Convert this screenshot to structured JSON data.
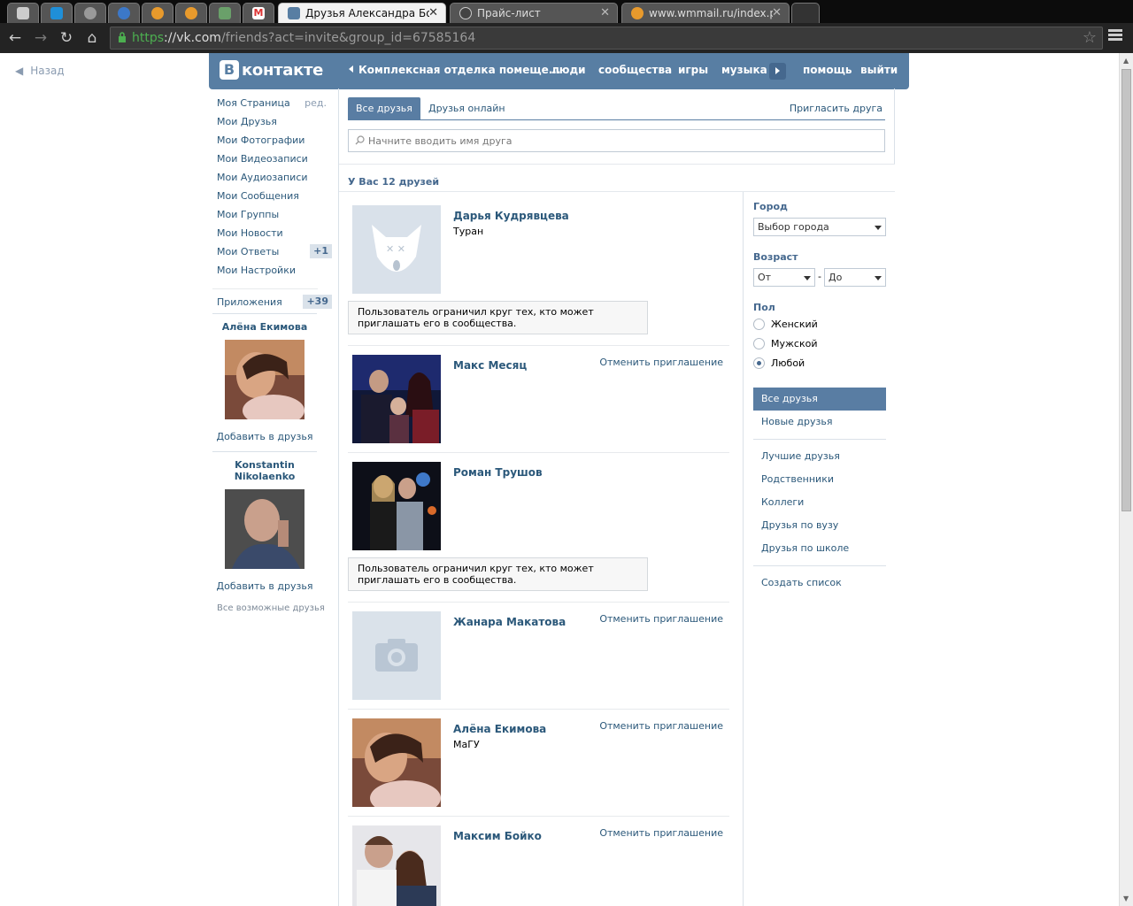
{
  "browser": {
    "tabs": [
      {
        "title": "Друзья Александра Бойк",
        "active": true
      },
      {
        "title": "Прайс-лист",
        "active": false
      },
      {
        "title": "www.wmmail.ru/index.ph",
        "active": false
      }
    ],
    "url_scheme": "https",
    "url_host": "://vk.com",
    "url_path": "/friends?act=invite&group_id=67585164"
  },
  "back_label": "Назад",
  "header": {
    "logo_letter": "В",
    "logo_word": "контакте",
    "nav": [
      "Комплексная отделка помеще...",
      "люди",
      "сообщества",
      "игры",
      "музыка",
      "помощь",
      "выйти"
    ]
  },
  "left_menu": {
    "items": [
      {
        "label": "Моя Страница",
        "extra": "ред."
      },
      {
        "label": "Мои Друзья"
      },
      {
        "label": "Мои Фотографии"
      },
      {
        "label": "Мои Видеозаписи"
      },
      {
        "label": "Мои Аудиозаписи"
      },
      {
        "label": "Мои Сообщения"
      },
      {
        "label": "Мои Группы"
      },
      {
        "label": "Мои Новости"
      },
      {
        "label": "Мои Ответы",
        "count": "+1"
      },
      {
        "label": "Мои Настройки"
      }
    ],
    "apps": {
      "label": "Приложения",
      "count": "+39"
    }
  },
  "suggestions": [
    {
      "name": "Алёна Екимова",
      "add": "Добавить в друзья"
    },
    {
      "name": "Konstantin Nikolaenko",
      "add": "Добавить в друзья"
    }
  ],
  "all_possible_friends": "Все возможные друзья",
  "tabs": {
    "all": "Все друзья",
    "online": "Друзья онлайн",
    "invite": "Пригласить друга"
  },
  "search": {
    "placeholder": "Начните вводить имя друга"
  },
  "friends_count": "У Вас 12 друзей",
  "restriction_text": "Пользователь ограничил круг тех, кто может приглашать его в сообщества.",
  "friends": [
    {
      "name": "Дарья Кудрявцева",
      "sub": "Туран",
      "cancel": ""
    },
    {
      "name": "Макс Месяц",
      "sub": "",
      "cancel": "Отменить приглашение"
    },
    {
      "name": "Роман Трушов",
      "sub": "",
      "cancel": ""
    },
    {
      "name": "Жанара Макатова",
      "sub": "",
      "cancel": "Отменить приглашение"
    },
    {
      "name": "Алёна Екимова",
      "sub": "МаГУ",
      "cancel": "Отменить приглашение"
    },
    {
      "name": "Максим Бойко",
      "sub": "",
      "cancel": "Отменить приглашение"
    }
  ],
  "filters": {
    "city_label": "Город",
    "city_value": "Выбор города",
    "age_label": "Возраст",
    "age_from": "От",
    "age_dash": "-",
    "age_to": "До",
    "sex_label": "Пол",
    "sex_options": [
      "Женский",
      "Мужской",
      "Любой"
    ],
    "sex_selected": "Любой",
    "lists": [
      "Все друзья",
      "Новые друзья",
      "Лучшие друзья",
      "Родственники",
      "Коллеги",
      "Друзья по вузу",
      "Друзья по школе",
      "Создать список"
    ]
  },
  "colors": {
    "accent": "#587ea3",
    "link": "#2b587a"
  }
}
